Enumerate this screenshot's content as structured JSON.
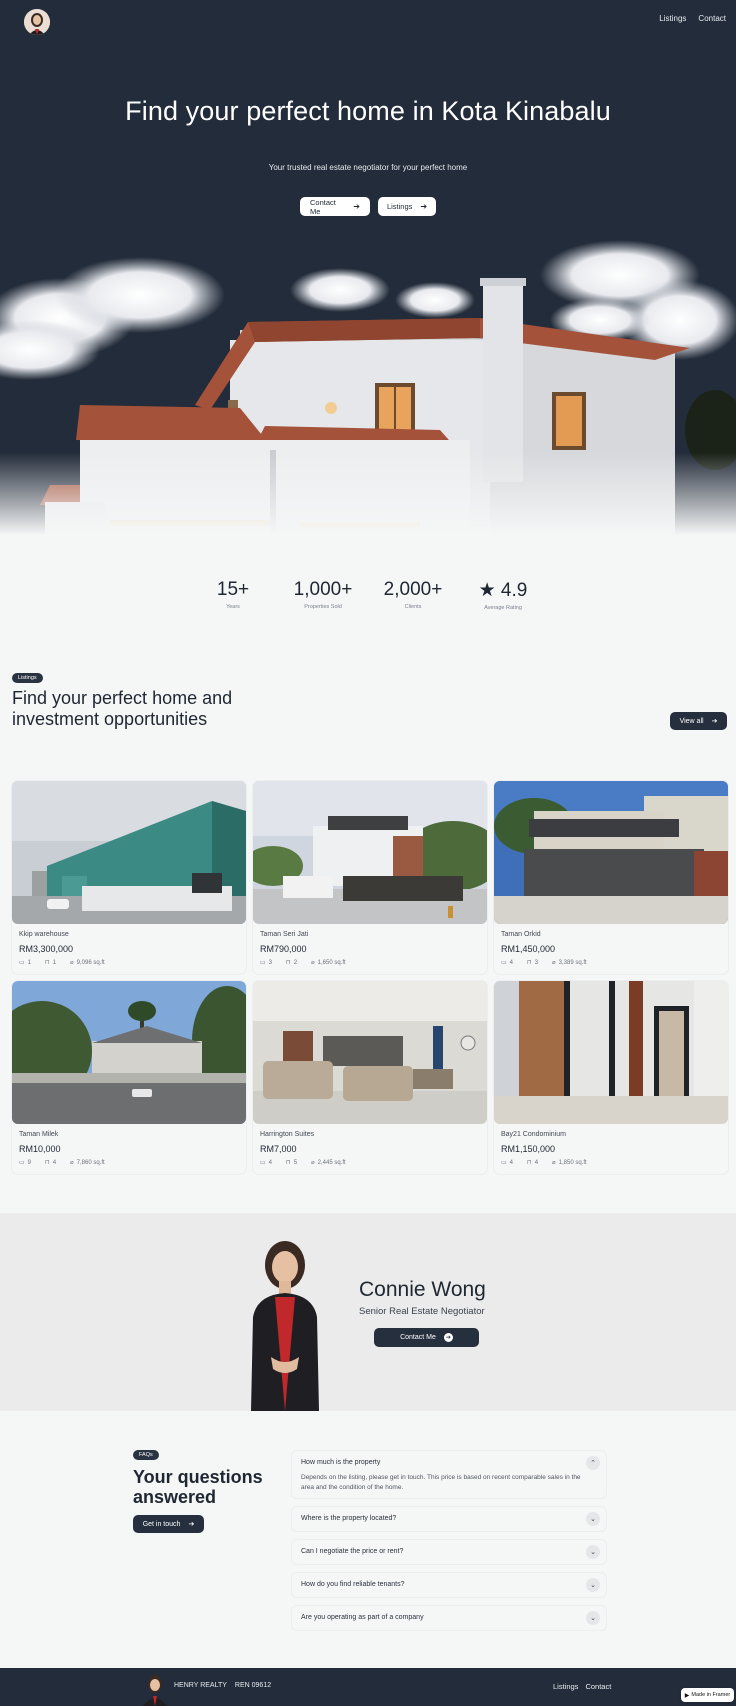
{
  "nav": {
    "links": [
      "Listings",
      "Contact"
    ]
  },
  "hero": {
    "title": "Find your perfect home in Kota Kinabalu",
    "subtitle": "Your trusted real estate negotiator for your perfect home",
    "buttons": [
      "Contact Me",
      "Listings"
    ]
  },
  "stats": [
    {
      "value": "15+",
      "label": "Years"
    },
    {
      "value": "1,000+",
      "label": "Properties Sold"
    },
    {
      "value": "2,000+",
      "label": "Clients"
    },
    {
      "value": "★ 4.9",
      "label": "Average Rating"
    }
  ],
  "listings": {
    "badge": "Listings",
    "title": "Find your perfect home and investment opportunities",
    "view_all": "View all",
    "items": [
      {
        "name": "Kkip warehouse",
        "price": "RM3,300,000",
        "beds": "1",
        "baths": "1",
        "area": "9,096 sq.ft"
      },
      {
        "name": "Taman Seri Jati",
        "price": "RM790,000",
        "beds": "3",
        "baths": "2",
        "area": "1,650 sq.ft"
      },
      {
        "name": "Taman Orkid",
        "price": "RM1,450,000",
        "beds": "4",
        "baths": "3",
        "area": "3,389 sq.ft"
      },
      {
        "name": "Taman Milek",
        "price": "RM10,000",
        "beds": "9",
        "baths": "4",
        "area": "7,860 sq.ft"
      },
      {
        "name": "Harrington Suites",
        "price": "RM7,000",
        "beds": "4",
        "baths": "5",
        "area": "2,445 sq.ft"
      },
      {
        "name": "Bay21 Condominium",
        "price": "RM1,150,000",
        "beds": "4",
        "baths": "4",
        "area": "1,850 sq.ft"
      }
    ]
  },
  "agent": {
    "name": "Connie Wong",
    "role": "Senior Real Estate Negotiator",
    "button": "Contact Me"
  },
  "faq": {
    "badge": "FAQs",
    "title": "Your questions answered",
    "cta": "Get in touch",
    "items": [
      {
        "q": "How much is the property",
        "a": "Depends on the listing, please get in touch. This price is based on recent comparable sales in the area and the condition of the home.",
        "open": true
      },
      {
        "q": "Where is the property located?",
        "a": "",
        "open": false
      },
      {
        "q": "Can I negotiate the price or rent?",
        "a": "",
        "open": false
      },
      {
        "q": "How do you find reliable tenants?",
        "a": "",
        "open": false
      },
      {
        "q": "Are you operating as part of a company",
        "a": "",
        "open": false
      }
    ]
  },
  "footer": {
    "brand": "HENRY REALTY",
    "reg": "REN 09612",
    "links": [
      "Listings",
      "Contact"
    ],
    "badge": "Made in Framer"
  },
  "colors": {
    "dark": "#232c3a",
    "background": "#f5f6f6",
    "agent_band": "#ebebeb"
  }
}
